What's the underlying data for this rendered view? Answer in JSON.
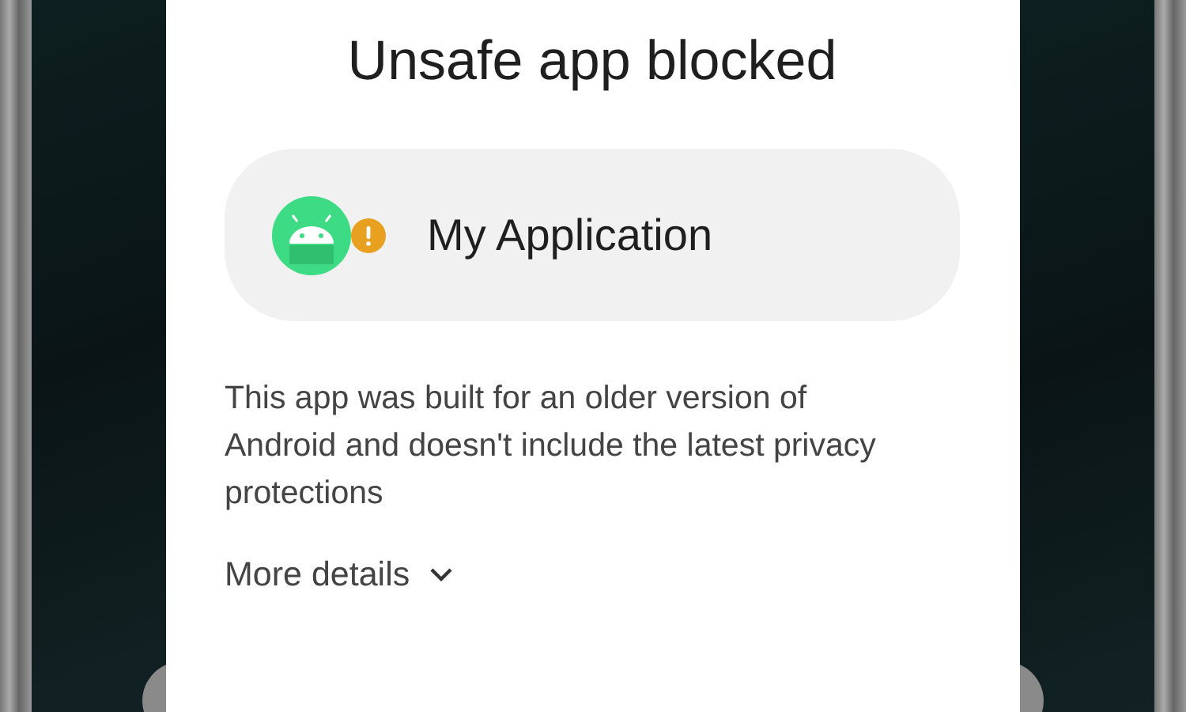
{
  "dialog": {
    "title": "Unsafe app blocked",
    "app": {
      "name": "My Application",
      "warning": true
    },
    "message": "This app was built for an older version of Android and doesn't include the latest privacy protections",
    "more_details": {
      "label": "More details",
      "expanded": false
    }
  }
}
